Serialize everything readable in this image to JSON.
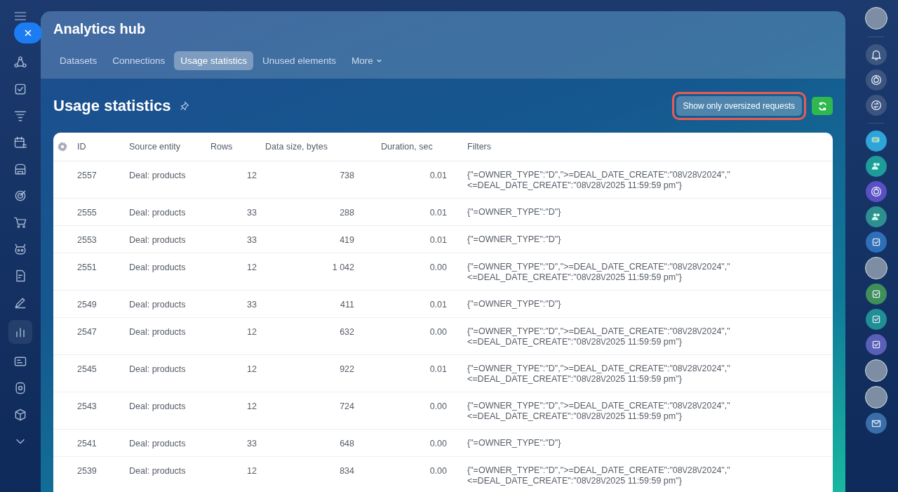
{
  "left_rail": {
    "items": [
      {
        "kind": "share",
        "selected": false
      },
      {
        "kind": "check",
        "selected": false
      },
      {
        "kind": "funnel",
        "selected": false
      },
      {
        "kind": "calendar",
        "selected": false
      },
      {
        "kind": "store",
        "selected": false
      },
      {
        "kind": "target",
        "selected": false
      },
      {
        "kind": "cart",
        "selected": false
      },
      {
        "kind": "robot",
        "selected": false
      },
      {
        "kind": "doc",
        "selected": false
      },
      {
        "kind": "pen",
        "selected": false
      },
      {
        "kind": "chart",
        "selected": true
      },
      {
        "kind": "card",
        "selected": false
      },
      {
        "kind": "disk",
        "selected": false
      },
      {
        "kind": "box",
        "selected": false
      },
      {
        "kind": "chevron",
        "selected": false
      }
    ]
  },
  "window": {
    "title": "Analytics hub"
  },
  "tabs": [
    {
      "label": "Datasets",
      "selected": false
    },
    {
      "label": "Connections",
      "selected": false
    },
    {
      "label": "Usage statistics",
      "selected": true
    },
    {
      "label": "Unused elements",
      "selected": false
    },
    {
      "label": "More",
      "selected": false,
      "kind": "menu"
    }
  ],
  "page": {
    "title": "Usage statistics",
    "oversized_button": "Show only oversized requests"
  },
  "table": {
    "columns": [
      "ID",
      "Source entity",
      "Rows",
      "Data size, bytes",
      "Duration, sec",
      "Filters"
    ],
    "rows": [
      {
        "id": "2557",
        "source": "Deal: products",
        "rows": "12",
        "size": "738",
        "duration": "0.01",
        "filters": [
          "{\"=OWNER_TYPE\":\"D\",\">=DEAL_DATE_CREATE\":\"08\\/28\\/2024\",\"",
          "<=DEAL_DATE_CREATE\":\"08\\/28\\/2025 11:59:59 pm\"}"
        ]
      },
      {
        "id": "2555",
        "source": "Deal: products",
        "rows": "33",
        "size": "288",
        "duration": "0.01",
        "filters": [
          "{\"=OWNER_TYPE\":\"D\"}"
        ]
      },
      {
        "id": "2553",
        "source": "Deal: products",
        "rows": "33",
        "size": "419",
        "duration": "0.01",
        "filters": [
          "{\"=OWNER_TYPE\":\"D\"}"
        ]
      },
      {
        "id": "2551",
        "source": "Deal: products",
        "rows": "12",
        "size": "1 042",
        "duration": "0.00",
        "filters": [
          "{\"=OWNER_TYPE\":\"D\",\">=DEAL_DATE_CREATE\":\"08\\/28\\/2024\",\"",
          "<=DEAL_DATE_CREATE\":\"08\\/28\\/2025 11:59:59 pm\"}"
        ]
      },
      {
        "id": "2549",
        "source": "Deal: products",
        "rows": "33",
        "size": "411",
        "duration": "0.01",
        "filters": [
          "{\"=OWNER_TYPE\":\"D\"}"
        ]
      },
      {
        "id": "2547",
        "source": "Deal: products",
        "rows": "12",
        "size": "632",
        "duration": "0.00",
        "filters": [
          "{\"=OWNER_TYPE\":\"D\",\">=DEAL_DATE_CREATE\":\"08\\/28\\/2024\",\"",
          "<=DEAL_DATE_CREATE\":\"08\\/28\\/2025 11:59:59 pm\"}"
        ]
      },
      {
        "id": "2545",
        "source": "Deal: products",
        "rows": "12",
        "size": "922",
        "duration": "0.01",
        "filters": [
          "{\"=OWNER_TYPE\":\"D\",\">=DEAL_DATE_CREATE\":\"08\\/28\\/2024\",\"",
          "<=DEAL_DATE_CREATE\":\"08\\/28\\/2025 11:59:59 pm\"}"
        ]
      },
      {
        "id": "2543",
        "source": "Deal: products",
        "rows": "12",
        "size": "724",
        "duration": "0.00",
        "filters": [
          "{\"=OWNER_TYPE\":\"D\",\">=DEAL_DATE_CREATE\":\"08\\/28\\/2024\",\"",
          "<=DEAL_DATE_CREATE\":\"08\\/28\\/2025 11:59:59 pm\"}"
        ]
      },
      {
        "id": "2541",
        "source": "Deal: products",
        "rows": "33",
        "size": "648",
        "duration": "0.00",
        "filters": [
          "{\"=OWNER_TYPE\":\"D\"}"
        ]
      },
      {
        "id": "2539",
        "source": "Deal: products",
        "rows": "12",
        "size": "834",
        "duration": "0.00",
        "filters": [
          "{\"=OWNER_TYPE\":\"D\",\">=DEAL_DATE_CREATE\":\"08\\/28\\/2024\",\"",
          "<=DEAL_DATE_CREATE\":\"08\\/28\\/2025 11:59:59 pm\"}"
        ]
      }
    ]
  },
  "right_rail": {
    "items": [
      {
        "kind": "avatar"
      },
      {
        "kind": "divider"
      },
      {
        "kind": "bell"
      },
      {
        "kind": "spiral"
      },
      {
        "kind": "swap"
      },
      {
        "kind": "divider"
      },
      {
        "kind": "chat",
        "color": "#2fa4d8"
      },
      {
        "kind": "group",
        "color": "#1e9c9a"
      },
      {
        "kind": "spiral",
        "color": "#5a4fc4"
      },
      {
        "kind": "group",
        "color": "#2d8f90"
      },
      {
        "kind": "task",
        "color": "#2f6fb8"
      },
      {
        "kind": "avatar"
      },
      {
        "kind": "task",
        "color": "#3f8f5a"
      },
      {
        "kind": "task",
        "color": "#1f8f95"
      },
      {
        "kind": "task",
        "color": "#5a5fb8"
      },
      {
        "kind": "avatar"
      },
      {
        "kind": "avatar"
      },
      {
        "kind": "mail",
        "color": "#3a6ea8"
      }
    ]
  }
}
